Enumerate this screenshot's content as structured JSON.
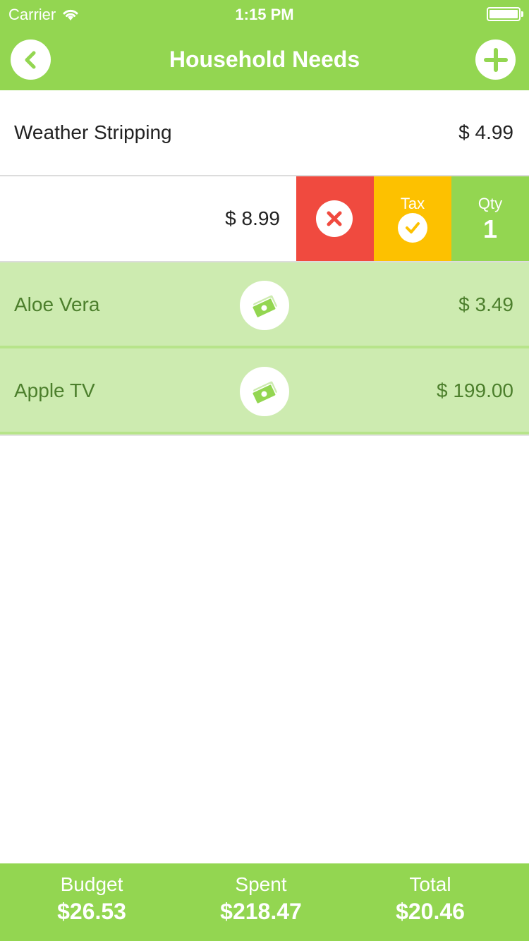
{
  "status_bar": {
    "carrier": "Carrier",
    "time": "1:15 PM"
  },
  "nav": {
    "title": "Household Needs",
    "back_icon": "chevron-left-icon",
    "add_icon": "plus-icon"
  },
  "items": [
    {
      "name": "Weather Stripping",
      "price": "$ 4.99",
      "state": "normal"
    },
    {
      "name": "",
      "price": "$ 8.99",
      "state": "swiped",
      "actions": {
        "delete_icon": "x-icon",
        "tax_label": "Tax",
        "tax_icon": "check-icon",
        "qty_label": "Qty",
        "qty_value": "1"
      }
    },
    {
      "name": "Aloe Vera",
      "price": "$ 3.49",
      "state": "purchased",
      "icon": "money-icon"
    },
    {
      "name": "Apple TV",
      "price": "$ 199.00",
      "state": "purchased",
      "icon": "money-icon"
    }
  ],
  "footer": {
    "budget_label": "Budget",
    "budget_value": "$26.53",
    "spent_label": "Spent",
    "spent_value": "$218.47",
    "total_label": "Total",
    "total_value": "$20.46"
  },
  "colors": {
    "accent": "#93d651",
    "delete": "#f04a3f",
    "tax": "#fdc100",
    "purchased_bg": "#cdebb0",
    "purchased_text": "#4c7f2c"
  }
}
